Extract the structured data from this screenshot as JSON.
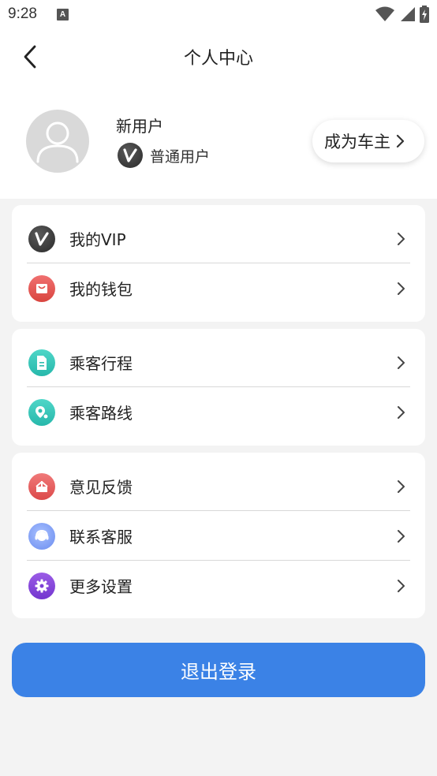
{
  "status_bar": {
    "time": "9:28",
    "notification_letter": "A"
  },
  "header": {
    "title": "个人中心"
  },
  "profile": {
    "name": "新用户",
    "member_level": "普通用户"
  },
  "become_owner_label": "成为车主",
  "sections": [
    {
      "items": [
        {
          "label": "我的VIP",
          "icon": "vip-icon"
        },
        {
          "label": "我的钱包",
          "icon": "wallet-icon"
        }
      ]
    },
    {
      "items": [
        {
          "label": "乘客行程",
          "icon": "document-icon"
        },
        {
          "label": "乘客路线",
          "icon": "route-icon"
        }
      ]
    },
    {
      "items": [
        {
          "label": "意见反馈",
          "icon": "feedback-icon"
        },
        {
          "label": "联系客服",
          "icon": "headset-icon"
        },
        {
          "label": "更多设置",
          "icon": "gear-icon"
        }
      ]
    }
  ],
  "logout_label": "退出登录",
  "colors": {
    "primary": "#3b82e6",
    "background": "#f3f3f3",
    "card": "#ffffff"
  }
}
